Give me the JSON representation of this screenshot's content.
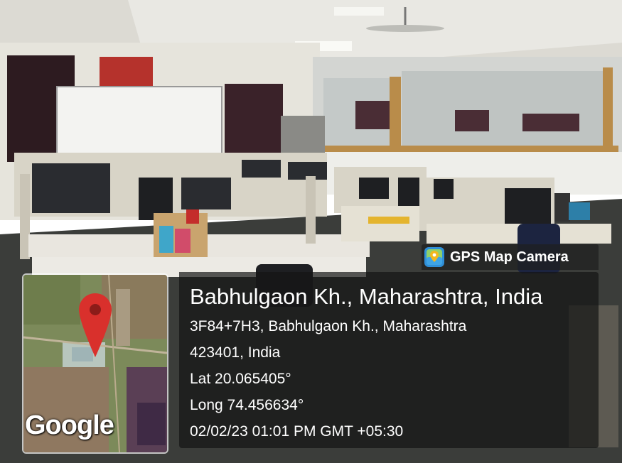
{
  "scene": {
    "description_icon": "computer-lab-photo",
    "colors": {
      "wall": "#e8e6df",
      "floor": "#3b3d3a",
      "curtain": "#2e1d22",
      "desk": "#e6e2d6"
    }
  },
  "badge": {
    "label": "GPS Map Camera",
    "icon": "gps-map-camera-logo"
  },
  "location": {
    "place": "Babhulgaon Kh., Maharashtra, India",
    "address_line1": "3F84+7H3, Babhulgaon Kh., Maharashtra",
    "address_line2": "423401, India",
    "lat": "Lat 20.065405°",
    "long": "Long 74.456634°",
    "datetime": "02/02/23 01:01 PM GMT +05:30"
  },
  "map": {
    "provider": "Google",
    "pin_icon": "map-pin-icon",
    "pin_color": "#d9302c"
  }
}
